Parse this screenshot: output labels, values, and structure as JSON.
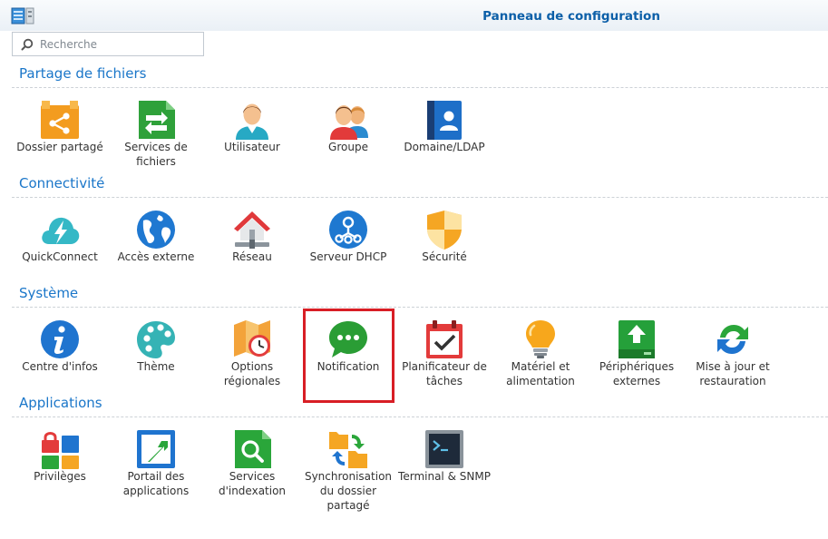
{
  "window": {
    "title": "Panneau de configuration"
  },
  "search": {
    "placeholder": "Recherche"
  },
  "sections": {
    "file_sharing": {
      "title": "Partage de fichiers",
      "items": [
        {
          "label": "Dossier partagé",
          "icon": "shared-folder-icon"
        },
        {
          "label": "Services de fichiers",
          "icon": "file-services-icon"
        },
        {
          "label": "Utilisateur",
          "icon": "user-icon"
        },
        {
          "label": "Groupe",
          "icon": "group-icon"
        },
        {
          "label": "Domaine/LDAP",
          "icon": "domain-ldap-icon"
        }
      ]
    },
    "connectivity": {
      "title": "Connectivité",
      "items": [
        {
          "label": "QuickConnect",
          "icon": "quickconnect-icon"
        },
        {
          "label": "Accès externe",
          "icon": "external-access-icon"
        },
        {
          "label": "Réseau",
          "icon": "network-icon"
        },
        {
          "label": "Serveur DHCP",
          "icon": "dhcp-server-icon"
        },
        {
          "label": "Sécurité",
          "icon": "security-shield-icon"
        }
      ]
    },
    "system": {
      "title": "Système",
      "items": [
        {
          "label": "Centre d'infos",
          "icon": "info-center-icon"
        },
        {
          "label": "Thème",
          "icon": "theme-palette-icon"
        },
        {
          "label": "Options régionales",
          "icon": "regional-options-icon"
        },
        {
          "label": "Notification",
          "icon": "notification-chat-icon"
        },
        {
          "label": "Planificateur de tâches",
          "icon": "task-scheduler-icon"
        },
        {
          "label": "Matériel et alimentation",
          "icon": "hardware-power-bulb-icon"
        },
        {
          "label": "Périphériques externes",
          "icon": "external-devices-icon"
        },
        {
          "label": "Mise à jour et restauration",
          "icon": "update-restore-icon"
        }
      ]
    },
    "applications": {
      "title": "Applications",
      "items": [
        {
          "label": "Privilèges",
          "icon": "privileges-icon"
        },
        {
          "label": "Portail des applications",
          "icon": "application-portal-icon"
        },
        {
          "label": "Services d'indexation",
          "icon": "indexing-service-icon"
        },
        {
          "label": "Synchronisation du dossier partagé",
          "icon": "shared-folder-sync-icon"
        },
        {
          "label": "Terminal & SNMP",
          "icon": "terminal-snmp-icon"
        }
      ]
    }
  },
  "colors": {
    "title": "#0c5fa8",
    "section": "#1a76c9",
    "highlight": "#d81e25"
  }
}
